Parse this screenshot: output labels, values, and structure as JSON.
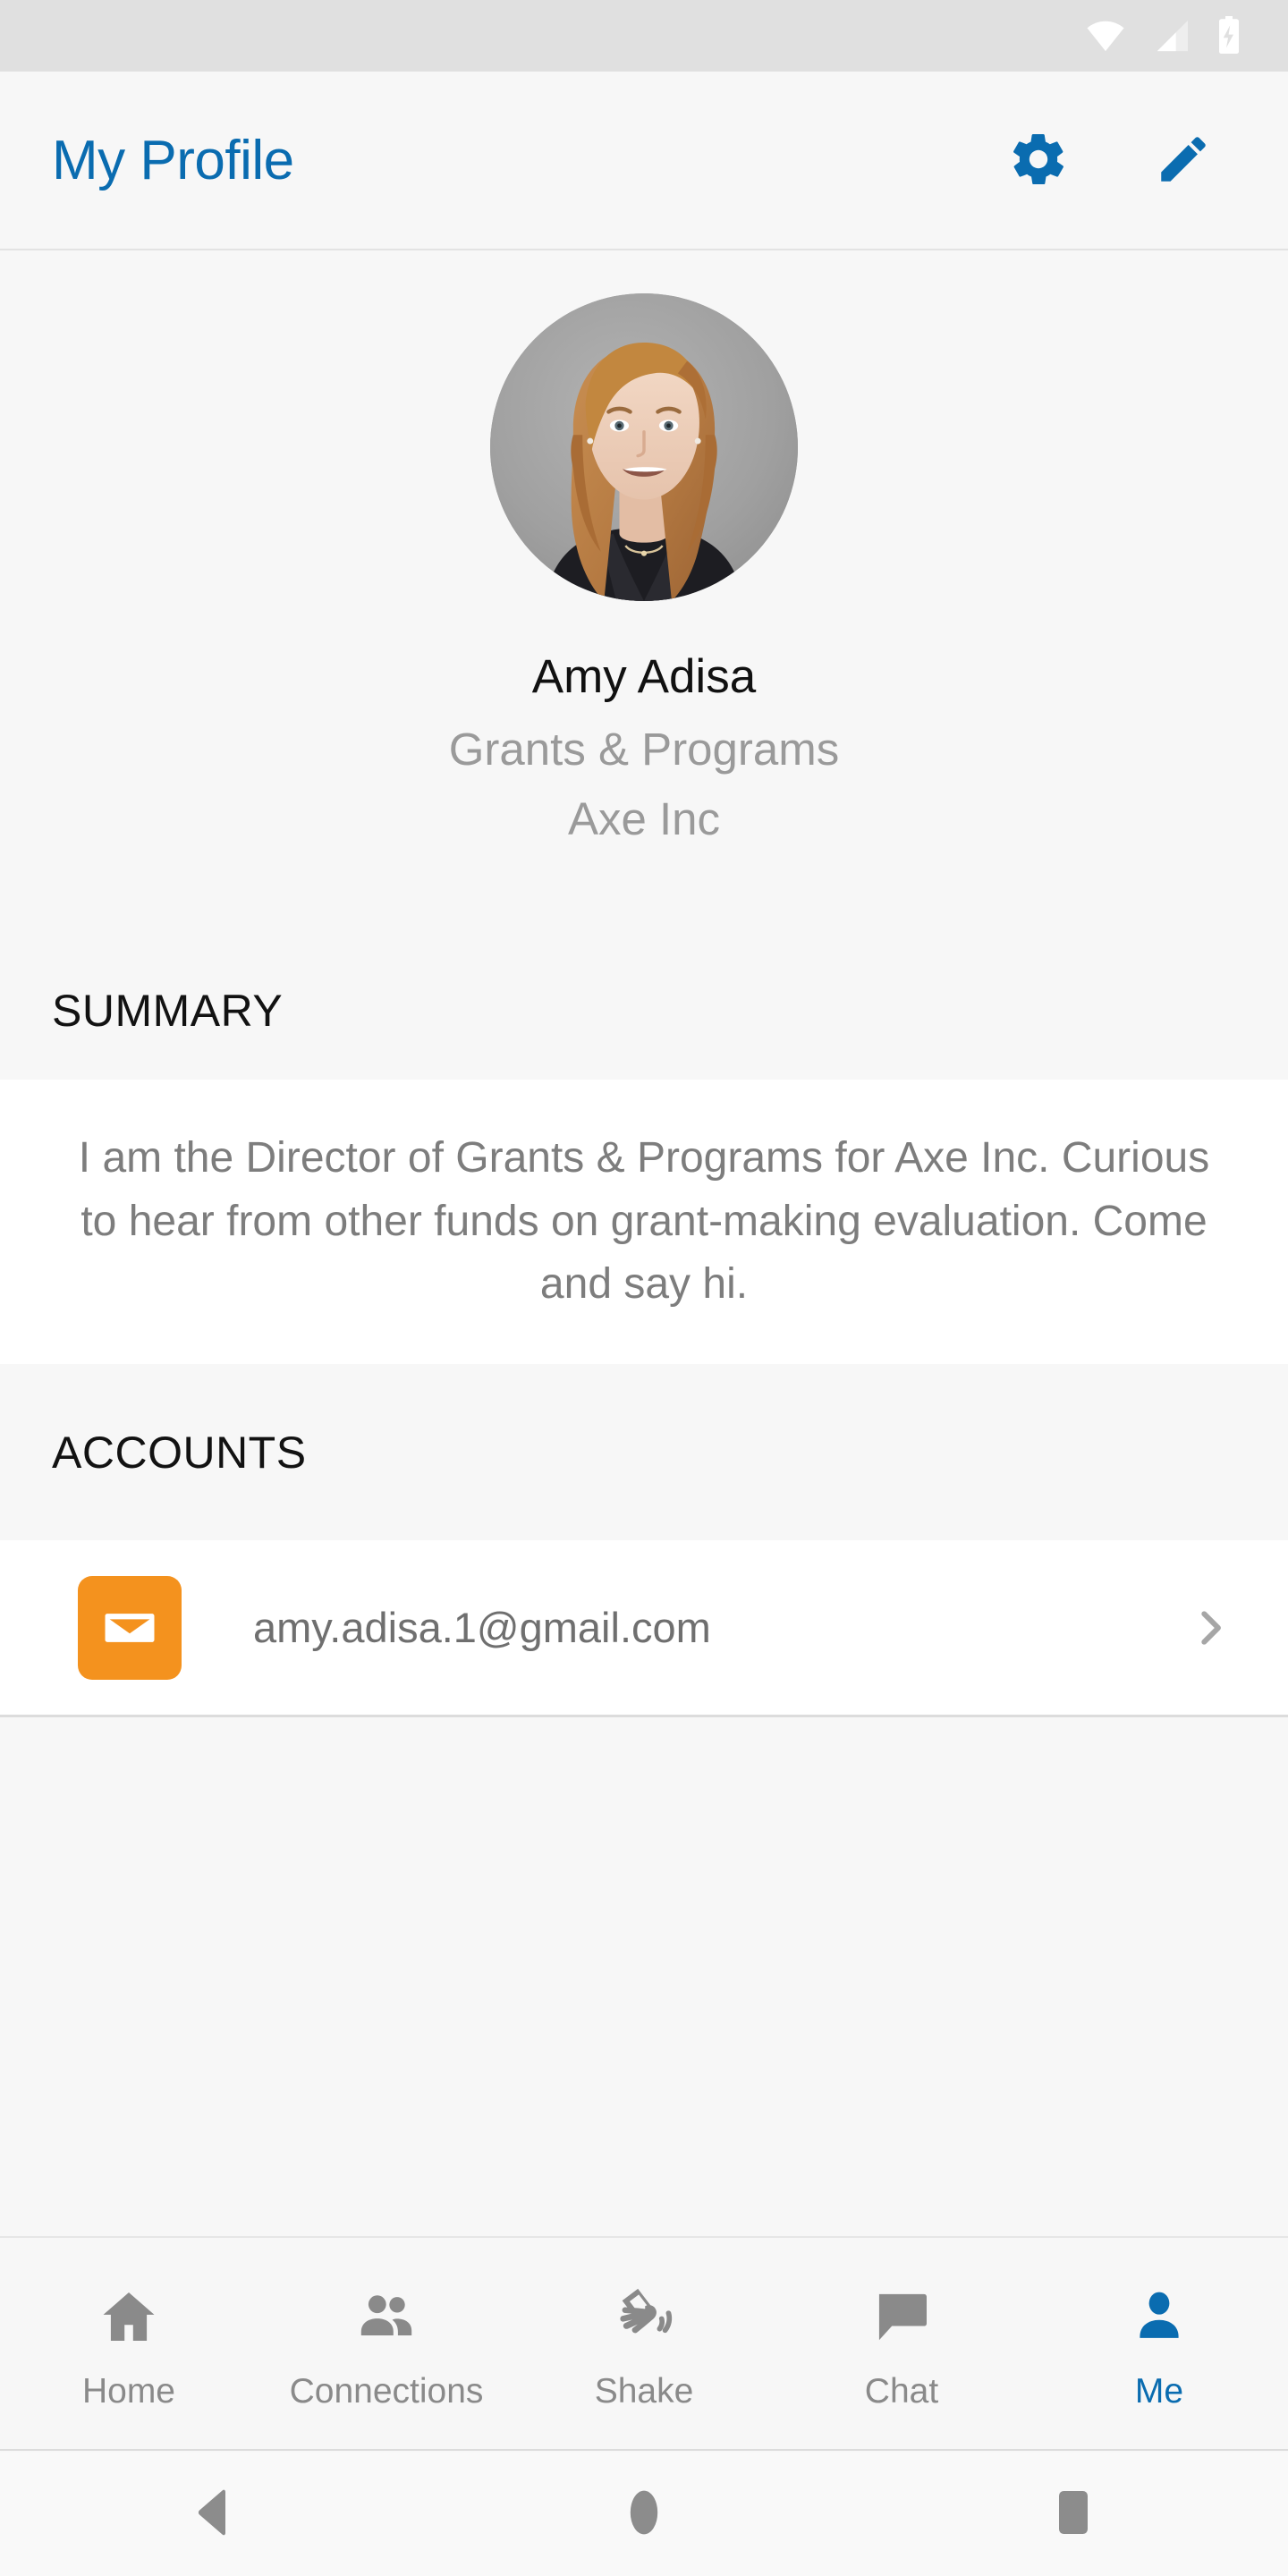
{
  "status_bar": {
    "icons": [
      "wifi-icon",
      "cellular-signal-icon",
      "battery-charging-icon"
    ]
  },
  "app_bar": {
    "title": "My Profile",
    "settings_icon": "gear-icon",
    "edit_icon": "pencil-icon",
    "title_color": "#0a6cb0"
  },
  "profile": {
    "avatar": "profile-photo",
    "name": "Amy Adisa",
    "subtitle": "Grants & Programs",
    "company": "Axe Inc"
  },
  "summary": {
    "label": "SUMMARY",
    "text": "I am the Director of Grants & Programs for Axe Inc. Curious to hear from other funds on grant-making evaluation. Come and say hi."
  },
  "accounts": {
    "label": "ACCOUNTS",
    "items": [
      {
        "icon": "email-envelope-icon",
        "icon_color": "#f4921e",
        "value": "amy.adisa.1@gmail.com",
        "chevron": "chevron-right-icon"
      }
    ]
  },
  "tab_bar": {
    "active_color": "#0a6cb0",
    "inactive_color": "#8a8a8a",
    "tabs": [
      {
        "label": "Home",
        "icon": "home-icon",
        "active": false
      },
      {
        "label": "Connections",
        "icon": "people-icon",
        "active": false
      },
      {
        "label": "Shake",
        "icon": "shake-phone-icon",
        "active": false
      },
      {
        "label": "Chat",
        "icon": "chat-bubble-icon",
        "active": false
      },
      {
        "label": "Me",
        "icon": "person-icon",
        "active": true
      }
    ]
  },
  "system_nav": {
    "back": "back-triangle-icon",
    "home": "home-circle-icon",
    "recents": "recents-square-icon"
  }
}
